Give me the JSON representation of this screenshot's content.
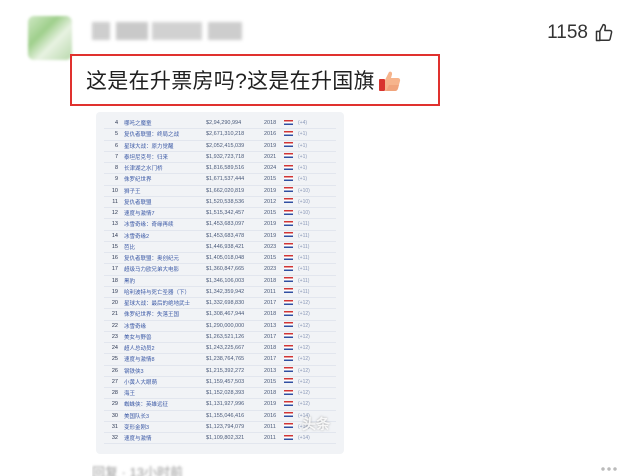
{
  "comment": {
    "like_count": "1158",
    "text": "这是在升票房吗?这是在升国旗",
    "emoji": "thumbs-up-emoji"
  },
  "image": {
    "watermark": "头条",
    "rows": [
      {
        "rank": "4",
        "title": "哪吒之魔童",
        "gross": "$2,94,290,994",
        "year": "2018",
        "note": "(+4)"
      },
      {
        "rank": "5",
        "title": "复仇者联盟：终局之战",
        "gross": "$2,671,310,218",
        "year": "2016",
        "note": "(+1)"
      },
      {
        "rank": "6",
        "title": "星球大战：原力觉醒",
        "gross": "$2,052,415,039",
        "year": "2019",
        "note": "(+1)"
      },
      {
        "rank": "7",
        "title": "泰坦尼克号：归来",
        "gross": "$1,932,723,718",
        "year": "2021",
        "note": "(+1)"
      },
      {
        "rank": "8",
        "title": "长津湖之水门桥",
        "gross": "$1,816,589,516",
        "year": "2024",
        "note": "(+1)"
      },
      {
        "rank": "9",
        "title": "侏罗纪世界",
        "gross": "$1,671,537,444",
        "year": "2015",
        "note": "(+1)"
      },
      {
        "rank": "10",
        "title": "狮子王",
        "gross": "$1,662,020,819",
        "year": "2019",
        "note": "(+10)"
      },
      {
        "rank": "11",
        "title": "复仇者联盟",
        "gross": "$1,520,538,536",
        "year": "2012",
        "note": "(+10)"
      },
      {
        "rank": "12",
        "title": "速度与激情7",
        "gross": "$1,515,342,457",
        "year": "2015",
        "note": "(+10)"
      },
      {
        "rank": "13",
        "title": "冰雪奇缘：奇缘再续",
        "gross": "$1,453,683,097",
        "year": "2019",
        "note": "(+11)"
      },
      {
        "rank": "14",
        "title": "冰雪奇缘2",
        "gross": "$1,453,683,478",
        "year": "2019",
        "note": "(+11)"
      },
      {
        "rank": "15",
        "title": "芭比",
        "gross": "$1,446,938,421",
        "year": "2023",
        "note": "(+11)"
      },
      {
        "rank": "16",
        "title": "复仇者联盟：奥创纪元",
        "gross": "$1,405,018,048",
        "year": "2015",
        "note": "(+11)"
      },
      {
        "rank": "17",
        "title": "超级马力欧兄弟大电影",
        "gross": "$1,360,847,665",
        "year": "2023",
        "note": "(+11)"
      },
      {
        "rank": "18",
        "title": "黑豹",
        "gross": "$1,346,106,003",
        "year": "2018",
        "note": "(+11)"
      },
      {
        "rank": "19",
        "title": "哈利波特与死亡圣器（下）",
        "gross": "$1,342,359,942",
        "year": "2011",
        "note": "(+11)"
      },
      {
        "rank": "20",
        "title": "星球大战：最后的绝地武士",
        "gross": "$1,332,698,830",
        "year": "2017",
        "note": "(+12)"
      },
      {
        "rank": "21",
        "title": "侏罗纪世界：失落王国",
        "gross": "$1,308,467,944",
        "year": "2018",
        "note": "(+12)"
      },
      {
        "rank": "22",
        "title": "冰雪奇缘",
        "gross": "$1,290,000,000",
        "year": "2013",
        "note": "(+12)"
      },
      {
        "rank": "23",
        "title": "美女与野兽",
        "gross": "$1,263,521,126",
        "year": "2017",
        "note": "(+12)"
      },
      {
        "rank": "24",
        "title": "超人总动员2",
        "gross": "$1,243,225,667",
        "year": "2018",
        "note": "(+12)"
      },
      {
        "rank": "25",
        "title": "速度与激情8",
        "gross": "$1,238,764,765",
        "year": "2017",
        "note": "(+12)"
      },
      {
        "rank": "26",
        "title": "钢铁侠3",
        "gross": "$1,215,392,272",
        "year": "2013",
        "note": "(+12)"
      },
      {
        "rank": "27",
        "title": "小黄人大眼萌",
        "gross": "$1,159,457,503",
        "year": "2015",
        "note": "(+12)"
      },
      {
        "rank": "28",
        "title": "海王",
        "gross": "$1,152,028,393",
        "year": "2018",
        "note": "(+12)"
      },
      {
        "rank": "29",
        "title": "蜘蛛侠：英雄远征",
        "gross": "$1,131,927,996",
        "year": "2019",
        "note": "(+12)"
      },
      {
        "rank": "30",
        "title": "美国队长3",
        "gross": "$1,155,046,416",
        "year": "2016",
        "note": "(+14)"
      },
      {
        "rank": "31",
        "title": "变形金刚3",
        "gross": "$1,123,794,079",
        "year": "2011",
        "note": "(+14)"
      },
      {
        "rank": "32",
        "title": "速度与激情",
        "gross": "$1,109,802,321",
        "year": "2011",
        "note": "(+14)"
      }
    ]
  },
  "footer": {
    "meta": "回复 · 13小时前"
  }
}
